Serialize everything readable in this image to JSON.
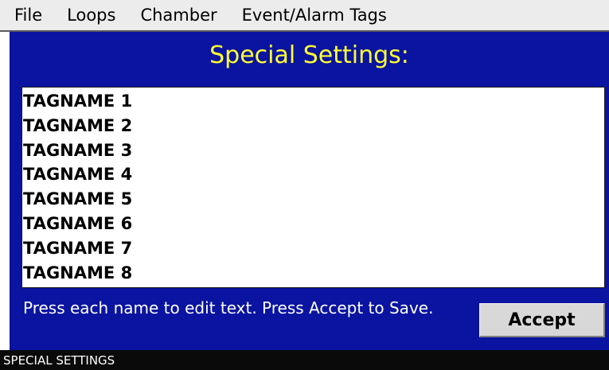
{
  "menu": {
    "items": [
      {
        "label": "File"
      },
      {
        "label": "Loops"
      },
      {
        "label": "Chamber"
      },
      {
        "label": "Event/Alarm Tags"
      }
    ]
  },
  "panel": {
    "title": "Special Settings:",
    "tags": [
      {
        "name": "TAGNAME 1"
      },
      {
        "name": "TAGNAME 2"
      },
      {
        "name": "TAGNAME 3"
      },
      {
        "name": "TAGNAME 4"
      },
      {
        "name": "TAGNAME 5"
      },
      {
        "name": "TAGNAME 6"
      },
      {
        "name": "TAGNAME 7"
      },
      {
        "name": "TAGNAME 8"
      }
    ],
    "hint": "Press each name to edit text. Press Accept to Save.",
    "accept_label": "Accept"
  },
  "status": {
    "text": "SPECIAL SETTINGS"
  },
  "colors": {
    "panel_background": "#0a14a0",
    "title_text": "#ffff33",
    "menubar_background": "#ececec",
    "statusbar_background": "#0a0a0a"
  }
}
